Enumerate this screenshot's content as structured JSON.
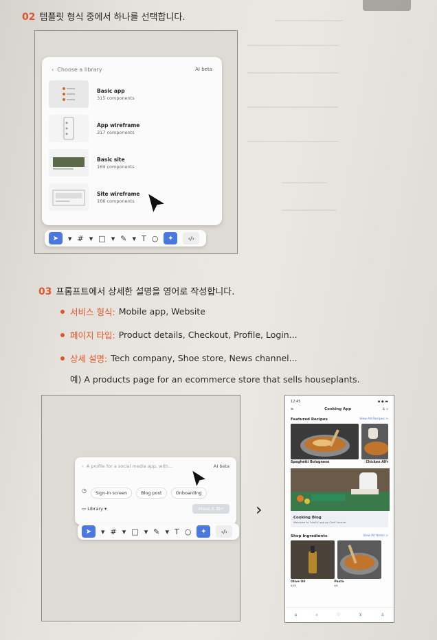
{
  "step02": {
    "num": "02",
    "text": "템플릿 형식 중에서 하나를 선택합니다."
  },
  "library": {
    "back_label": "Choose a library",
    "ai_badge": "AI beta",
    "items": [
      {
        "name": "Basic app",
        "count": "315 components"
      },
      {
        "name": "App wireframe",
        "count": "317 components"
      },
      {
        "name": "Basic site",
        "count": "169 components"
      },
      {
        "name": "Site wireframe",
        "count": "166 components"
      }
    ]
  },
  "step03": {
    "num": "03",
    "text": "프롬프트에서 상세한 설명을 영어로 작성합니다."
  },
  "bullets": [
    {
      "label": "서비스 형식:",
      "value": "Mobile app, Website"
    },
    {
      "label": "페이지 타입:",
      "value": "Product details, Checkout, Profile, Login..."
    },
    {
      "label": "상세 설명:",
      "value": "Tech company, Shoe store, News channel..."
    }
  ],
  "example": "예) A products page for an ecommerce store that sells houseplants.",
  "prompt": {
    "placeholder": "A profile for a social media app, with...",
    "ai_badge": "AI beta",
    "chips": [
      "Sign-in screen",
      "Blog post",
      "Onboarding"
    ],
    "library_label": "Library",
    "make_label": "Make it ⌘↵"
  },
  "arrow": "›",
  "phone": {
    "time": "12:45",
    "title": "Cooking App",
    "featured_heading": "Featured Recipes",
    "featured_link": "View All Recipes >",
    "recipes": [
      "Spaghetti Bolognese",
      "Chicken Alfr"
    ],
    "blog_title": "Cooking Blog",
    "blog_sub": "Welcome to 'chef's' app by Chef' lecture",
    "ingredients_heading": "Shop Ingredients",
    "ingredients_link": "View All Items >",
    "products": [
      {
        "name": "Olive Oil",
        "price": "$10"
      },
      {
        "name": "Pasta",
        "price": "$3"
      }
    ]
  },
  "colors": {
    "accent": "#e0562c",
    "figma_blue": "#4a78e0",
    "page_bg": "#e6e2dc"
  }
}
